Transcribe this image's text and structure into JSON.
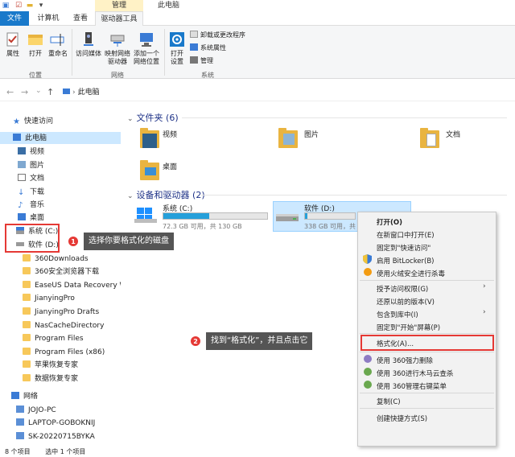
{
  "title_bar": {
    "context_tab_header": "管理",
    "window_title": "此电脑"
  },
  "tabs": [
    {
      "label": "文件"
    },
    {
      "label": "计算机"
    },
    {
      "label": "查看"
    },
    {
      "label": "驱动器工具"
    }
  ],
  "ribbon": {
    "location": {
      "label": "位置",
      "buttons": [
        "属性",
        "打开",
        "重命名"
      ]
    },
    "network": {
      "label": "网络",
      "buttons": [
        {
          "l1": "访问媒体",
          "l2": ""
        },
        {
          "l1": "映射网络",
          "l2": "驱动器"
        },
        {
          "l1": "添加一个",
          "l2": "网络位置"
        }
      ]
    },
    "system": {
      "label": "系统",
      "open_settings": [
        "打开",
        "设置"
      ],
      "commands": [
        "卸载或更改程序",
        "系统属性",
        "管理"
      ]
    }
  },
  "nav": {
    "back": "←",
    "forward": "→",
    "recent": "⌄",
    "up": "↑",
    "path": "此电脑"
  },
  "sidebar": {
    "quick_access": "快速访问",
    "this_pc": "此电脑",
    "items": [
      "视频",
      "图片",
      "文档",
      "下载",
      "音乐",
      "桌面",
      "系统 (C:)",
      "软件 (D:)"
    ],
    "folders": [
      "360Downloads",
      "360安全浏览器下载",
      "EaseUS Data Recovery Wiza",
      "JianyingPro",
      "JianyingPro Drafts",
      "NasCacheDirectory",
      "Program Files",
      "Program Files (x86)",
      "苹果恢复专家",
      "数据恢复专家"
    ],
    "network": "网络",
    "network_items": [
      "JOJO-PC",
      "LAPTOP-GOBOKNIJ",
      "SK-20220715BYKA"
    ]
  },
  "content": {
    "folders_header": "文件夹 (6)",
    "folders": [
      "视频",
      "图片",
      "文档",
      "桌面"
    ],
    "drives_header": "设备和驱动器 (2)",
    "drives": [
      {
        "name": "系统 (C:)",
        "detail": "72.3 GB 可用，共 130 GB",
        "used_fraction": 0.44
      },
      {
        "name": "软件 (D:)",
        "detail": "338 GB 可用，共",
        "used_fraction": 0.05
      }
    ]
  },
  "status": {
    "items_count": "8 个项目",
    "selected": "选中 1 个项目"
  },
  "callouts": [
    {
      "num": "1",
      "text": "选择你要格式化的磁盘"
    },
    {
      "num": "2",
      "text": "找到“格式化”，并且点击它"
    }
  ],
  "context_menu": {
    "items": [
      "打开(O)",
      "在新窗口中打开(E)",
      "固定到\"快速访问\"",
      "启用 BitLocker(B)",
      "使用火绒安全进行杀毒",
      "授予访问权限(G)",
      "还原以前的版本(V)",
      "包含到库中(I)",
      "固定到\"开始\"屏幕(P)",
      "格式化(A)...",
      "使用 360强力删除",
      "使用 360进行木马云查杀",
      "使用 360管理右键菜单",
      "复制(C)",
      "创建快捷方式(S)"
    ],
    "submenu_arrow": "›"
  },
  "colors": {
    "accent": "#1979ca",
    "callout_red": "#e53935",
    "drive_bar": "#26a0da"
  }
}
